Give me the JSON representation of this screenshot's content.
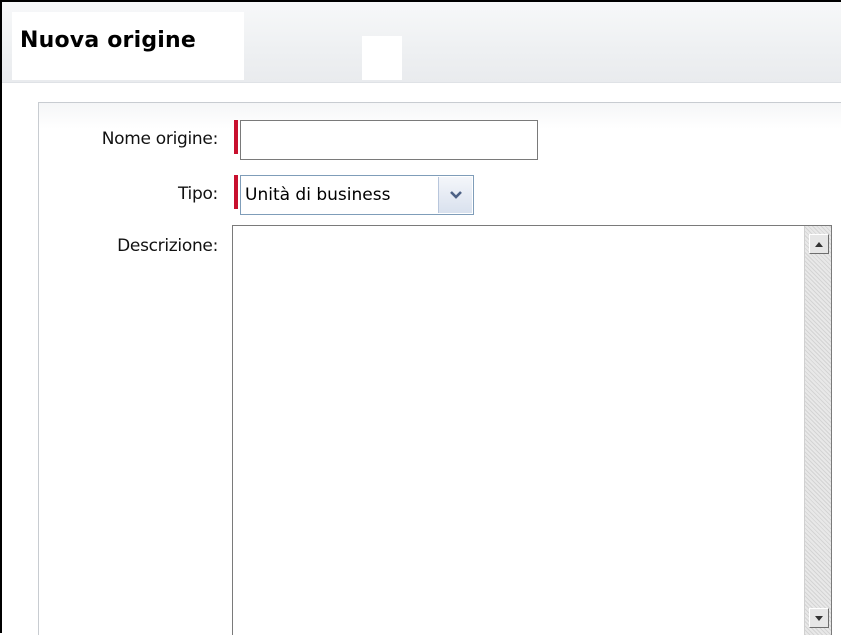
{
  "dialog": {
    "title": "Nuova origine"
  },
  "form": {
    "name": {
      "label": "Nome origine:",
      "value": "",
      "required": true
    },
    "type": {
      "label": "Tipo:",
      "selected": "Unità di business",
      "required": true
    },
    "description": {
      "label": "Descrizione:",
      "value": ""
    }
  },
  "colors": {
    "required_marker": "#c8102e",
    "field_border": "#7a7a7a",
    "select_border": "#7f9db9"
  },
  "icons": {
    "select_arrow": "chevron-down-icon",
    "scroll_up": "arrow-up-icon",
    "scroll_down": "arrow-down-icon"
  }
}
